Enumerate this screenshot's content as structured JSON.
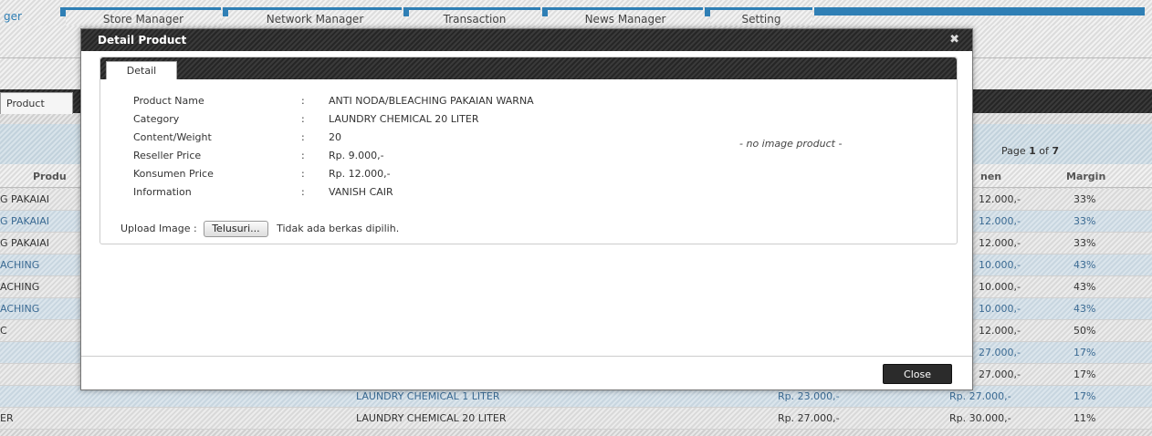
{
  "nav": {
    "tabs": [
      "ger",
      "Store Manager",
      "Network Manager",
      "Transaction",
      "News Manager",
      "Setting"
    ]
  },
  "page": {
    "product_tab": "Product",
    "pagination": {
      "prefix": "Page ",
      "current": "1",
      "middle": " of ",
      "total": "7"
    },
    "columns": {
      "product": "Produ",
      "konsumen": "nen",
      "margin": "Margin"
    },
    "rows": [
      {
        "name": "G PAKAIAI",
        "category": "",
        "reseller": "",
        "konsumen": "12.000,-",
        "margin": "33%",
        "style": "norm"
      },
      {
        "name": "G PAKAIAI",
        "category": "",
        "reseller": "",
        "konsumen": "12.000,-",
        "margin": "33%",
        "style": "alt"
      },
      {
        "name": "G PAKAIAI",
        "category": "",
        "reseller": "",
        "konsumen": "12.000,-",
        "margin": "33%",
        "style": "norm"
      },
      {
        "name": "ACHING",
        "category": "",
        "reseller": "",
        "konsumen": "10.000,-",
        "margin": "43%",
        "style": "alt"
      },
      {
        "name": "ACHING",
        "category": "",
        "reseller": "",
        "konsumen": "10.000,-",
        "margin": "43%",
        "style": "norm"
      },
      {
        "name": "ACHING",
        "category": "",
        "reseller": "",
        "konsumen": "10.000,-",
        "margin": "43%",
        "style": "alt"
      },
      {
        "name": "C",
        "category": "",
        "reseller": "",
        "konsumen": "12.000,-",
        "margin": "50%",
        "style": "norm"
      },
      {
        "name": "",
        "category": "",
        "reseller": "",
        "konsumen": "27.000,-",
        "margin": "17%",
        "style": "alt"
      },
      {
        "name": "",
        "category": "",
        "reseller": "",
        "konsumen": "27.000,-",
        "margin": "17%",
        "style": "norm"
      },
      {
        "name": "",
        "category": "LAUNDRY CHEMICAL 1 LITER",
        "reseller": "Rp. 23.000,-",
        "konsumen": "Rp. 27.000,-",
        "margin": "17%",
        "style": "alt"
      },
      {
        "name": "ER",
        "category": "LAUNDRY CHEMICAL 20 LITER",
        "reseller": "Rp. 27.000,-",
        "konsumen": "Rp. 30.000,-",
        "margin": "11%",
        "style": "norm"
      }
    ]
  },
  "modal": {
    "title": "Detail Product",
    "close_glyph": "✖",
    "tab": "Detail",
    "fields": [
      {
        "label": "Product Name",
        "value": "ANTI NODA/BLEACHING PAKAIAN WARNA"
      },
      {
        "label": "Category",
        "value": "LAUNDRY CHEMICAL 20 LITER"
      },
      {
        "label": "Content/Weight",
        "value": "20"
      },
      {
        "label": "Reseller Price",
        "value": "Rp. 9.000,-"
      },
      {
        "label": "Konsumen Price",
        "value": "Rp. 12.000,-"
      },
      {
        "label": "Information",
        "value": "VANISH CAIR"
      }
    ],
    "colon": ":",
    "no_image": "- no image product -",
    "upload_label": "Upload Image :",
    "browse_label": "Telusuri...",
    "no_file": "Tidak ada berkas dipilih.",
    "close_button": "Close"
  }
}
